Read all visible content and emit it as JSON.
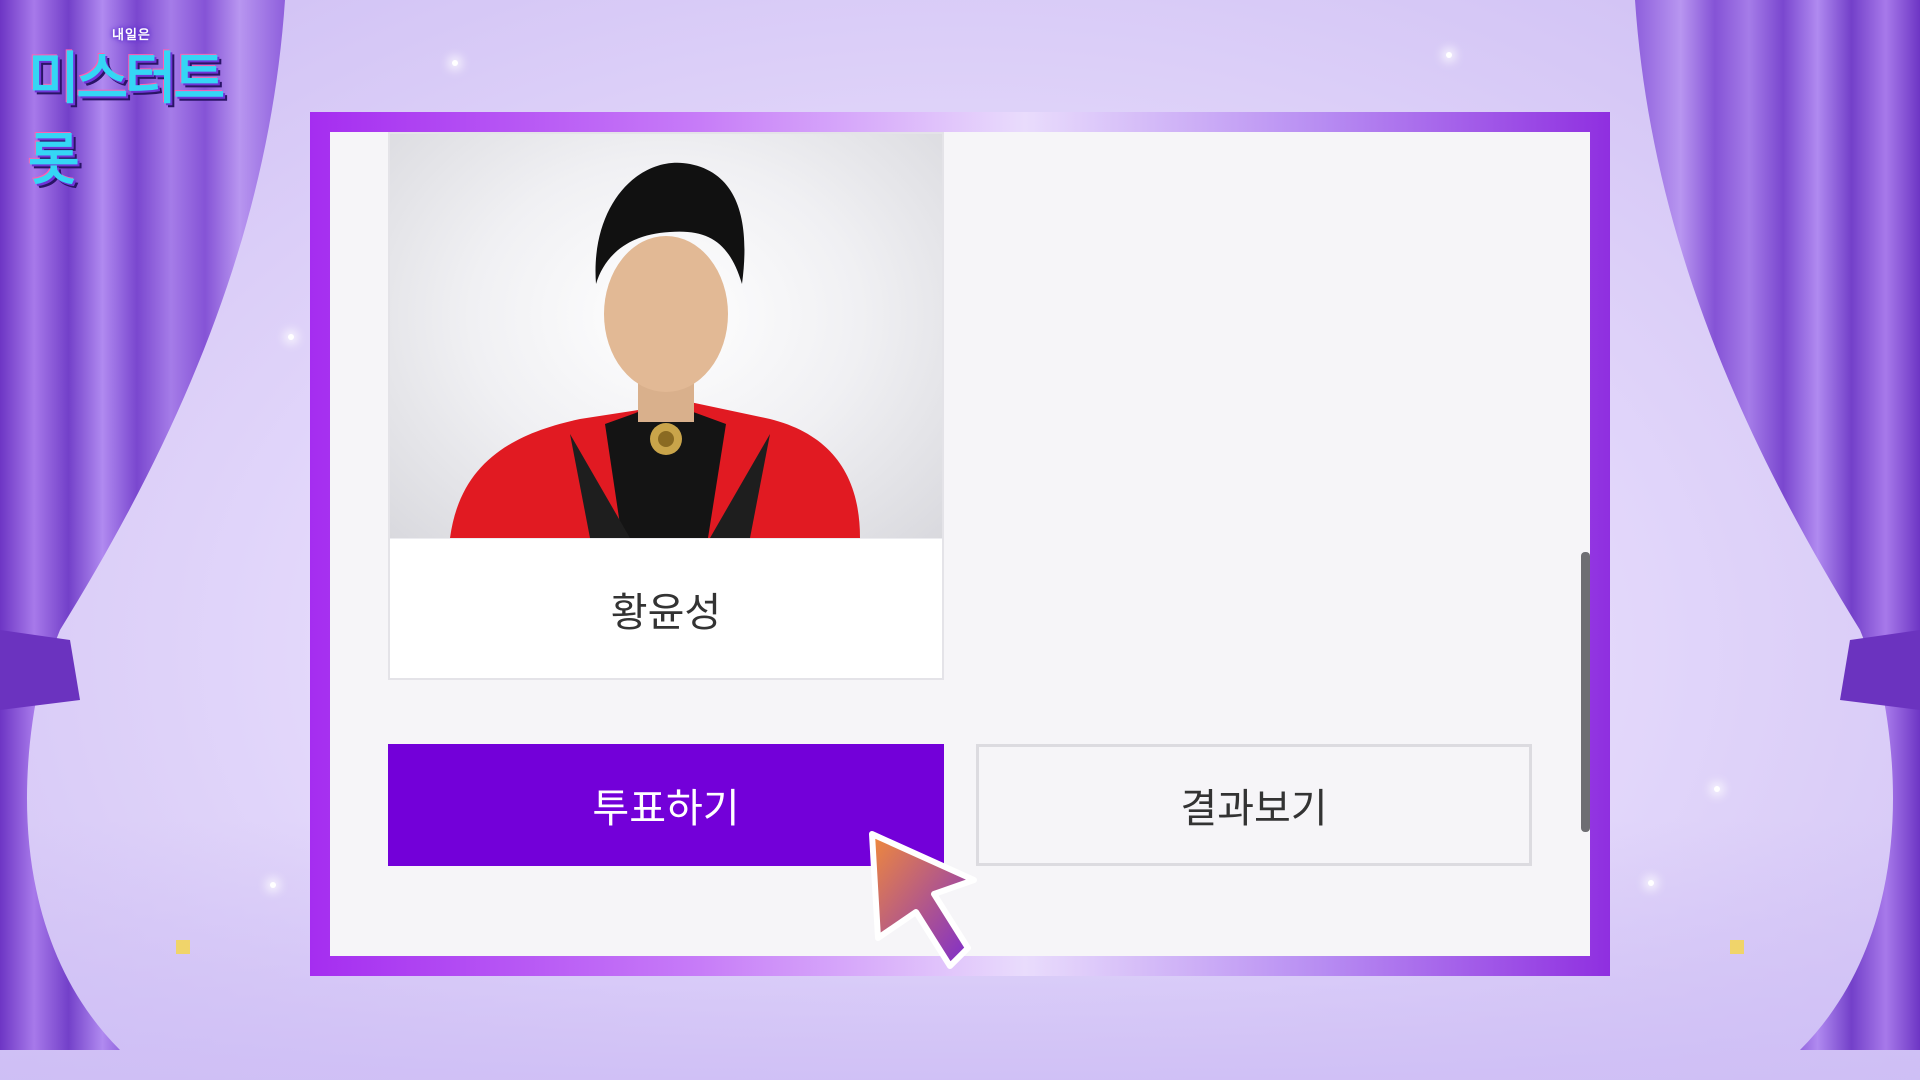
{
  "logo": {
    "small_text": "내일은",
    "main_text": "미스터트롯"
  },
  "candidate": {
    "name": "황윤성"
  },
  "buttons": {
    "vote_label": "투표하기",
    "result_label": "결과보기"
  },
  "colors": {
    "vote_button": "#7300d9",
    "frame_accent": "#a52df0",
    "curtain": "#8a52d6",
    "cursor_gradient_start": "#f08a3a",
    "cursor_gradient_end": "#7a2ad2"
  },
  "icons": {
    "cursor": "arrow-pointer-icon"
  }
}
